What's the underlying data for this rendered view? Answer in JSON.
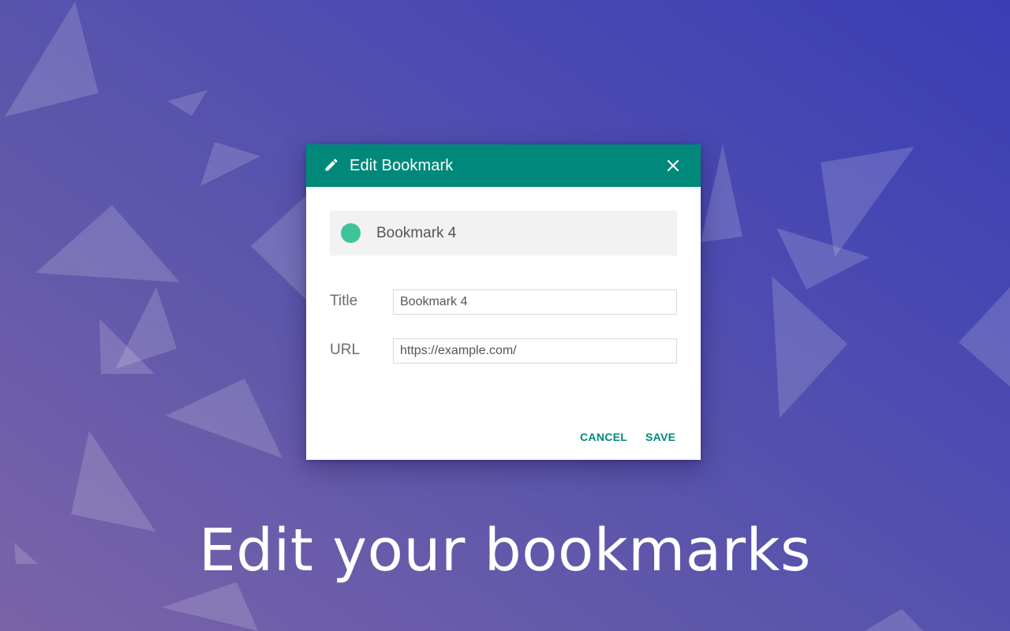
{
  "dialog": {
    "title": "Edit Bookmark",
    "header_icon": "pencil-icon",
    "close_icon": "close-icon",
    "header_color": "#00897b",
    "preview": {
      "title": "Bookmark 4",
      "dot_color": "#3ec49a"
    },
    "fields": {
      "title": {
        "label": "Title",
        "value": "Bookmark 4"
      },
      "url": {
        "label": "URL",
        "value": "https://example.com/"
      }
    },
    "actions": {
      "cancel": "CANCEL",
      "save": "SAVE"
    }
  },
  "tagline": "Edit your bookmarks"
}
